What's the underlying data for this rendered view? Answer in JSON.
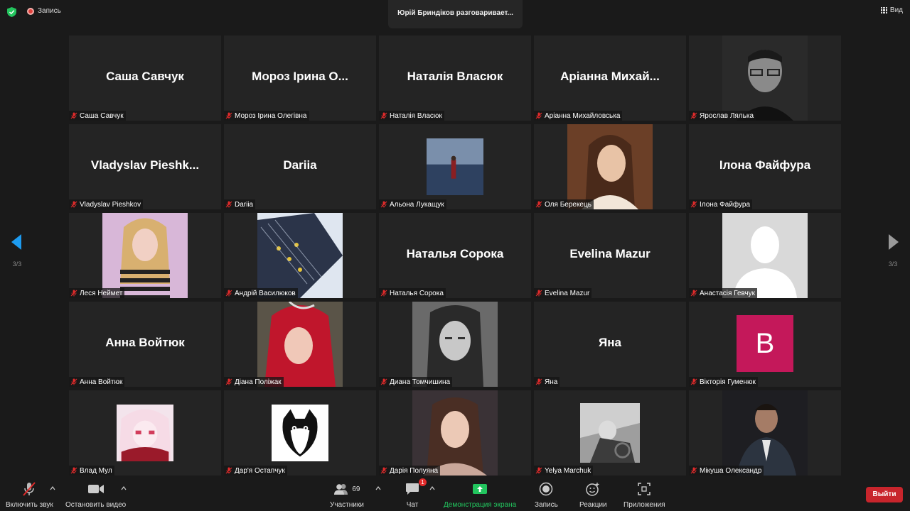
{
  "topbar": {
    "record_label": "Запись",
    "speaker_text": "Юрій Бриндіков разговаривает...",
    "view_label": "Вид",
    "colors": {
      "shield": "#23c55e",
      "record": "#e0403c"
    }
  },
  "pager": {
    "left_page": "3/3",
    "right_page": "3/3"
  },
  "participants": [
    {
      "display": "Саша Савчук",
      "label": "Саша Савчук"
    },
    {
      "display": "Мороз Ірина О...",
      "label": "Мороз Ірина Олегівна"
    },
    {
      "display": "Наталія Власюк",
      "label": "Наталія Власюк"
    },
    {
      "display": "Аріанна Михай...",
      "label": "Аріанна Михайловська"
    },
    {
      "display": "",
      "label": "Ярослав Лялька",
      "video": "dark-portrait"
    },
    {
      "display": "Vladyslav Pieshk...",
      "label": "Vladyslav Pieshkov"
    },
    {
      "display": "Dariia",
      "label": "Dariia"
    },
    {
      "display": "",
      "label": "Альона Лукащук",
      "video": "sea"
    },
    {
      "display": "",
      "label": "Оля Берекець",
      "video": "portrait-warm"
    },
    {
      "display": "Ілона Файфура",
      "label": "Ілона Файфура"
    },
    {
      "display": "",
      "label": "Леся Неймет",
      "video": "portrait-stripes"
    },
    {
      "display": "",
      "label": "Андрій Василюков",
      "video": "fabric"
    },
    {
      "display": "Наталья Сорока",
      "label": "Наталья Сорока"
    },
    {
      "display": "Evelina Mazur",
      "label": "Evelina Mazur"
    },
    {
      "display": "",
      "label": "Анастасія Гевчук",
      "video": "silhouette"
    },
    {
      "display": "Анна Войтюк",
      "label": "Анна Войтюк"
    },
    {
      "display": "",
      "label": "Діана Поліжак",
      "video": "portrait-red"
    },
    {
      "display": "",
      "label": "Диана Томчишина",
      "video": "portrait-bw"
    },
    {
      "display": "Яна",
      "label": "Яна"
    },
    {
      "display": "",
      "label": "Вікторія Гуменюк",
      "avatar_letter": "B"
    },
    {
      "display": "",
      "label": "Влад Мул",
      "video": "anime"
    },
    {
      "display": "",
      "label": "Дар'я Остапчук",
      "video": "cat"
    },
    {
      "display": "",
      "label": "Дарія Полуяна",
      "video": "portrait-soft"
    },
    {
      "display": "",
      "label": "Yelya Marchuk",
      "video": "car"
    },
    {
      "display": "",
      "label": "Мікуша Олександр",
      "video": "portrait-suit"
    }
  ],
  "toolbar": {
    "unmute_label": "Включить звук",
    "video_label": "Остановить видео",
    "participants_label": "Участники",
    "participants_count": "69",
    "chat_label": "Чат",
    "chat_badge": "1",
    "share_label": "Демонстрация экрана",
    "record_label": "Запись",
    "reactions_label": "Реакции",
    "apps_label": "Приложения",
    "leave_label": "Выйти",
    "colors": {
      "share": "#22c55e",
      "leave": "#c8252c",
      "mute": "#e22b2b"
    }
  }
}
